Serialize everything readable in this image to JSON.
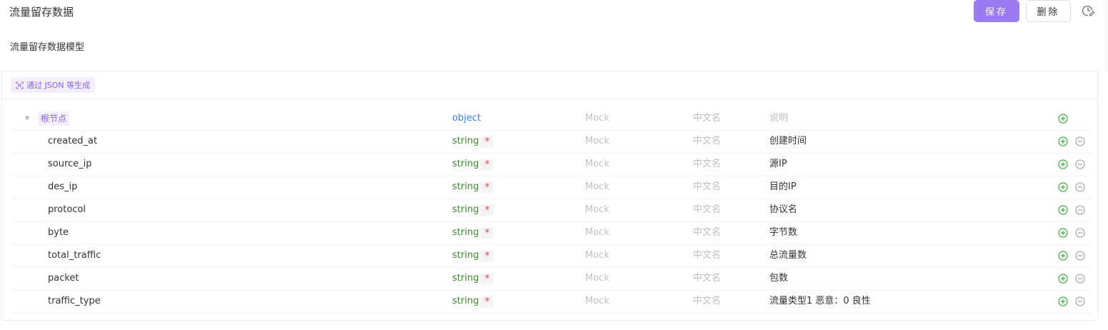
{
  "header": {
    "title": "流量留存数据",
    "save_label": "保存",
    "delete_label": "删除",
    "history_icon": "history-edit-icon"
  },
  "model": {
    "name": "流量留存数据模型"
  },
  "toolbar": {
    "generate_label": "通过 JSON 等生成",
    "generate_icon": "scan-icon"
  },
  "colors": {
    "accent": "#9b7cf0",
    "type_object": "#3c7fd9",
    "type_string": "#3a8c2c",
    "required": "#e8413c",
    "add_icon": "#3aa63a",
    "placeholder": "#bfbfbf"
  },
  "schema": {
    "root": {
      "name": "根节点",
      "type": "object",
      "mock_placeholder": "Mock",
      "cn_placeholder": "中文名",
      "desc_placeholder": "说明"
    },
    "fields": [
      {
        "name": "created_at",
        "type": "string",
        "required": "*",
        "mock": "Mock",
        "cn": "中文名",
        "desc": "创建时间"
      },
      {
        "name": "source_ip",
        "type": "string",
        "required": "*",
        "mock": "Mock",
        "cn": "中文名",
        "desc": "源IP"
      },
      {
        "name": "des_ip",
        "type": "string",
        "required": "*",
        "mock": "Mock",
        "cn": "中文名",
        "desc": "目的IP"
      },
      {
        "name": "protocol",
        "type": "string",
        "required": "*",
        "mock": "Mock",
        "cn": "中文名",
        "desc": "协议名"
      },
      {
        "name": "byte",
        "type": "string",
        "required": "*",
        "mock": "Mock",
        "cn": "中文名",
        "desc": "字节数"
      },
      {
        "name": "total_traffic",
        "type": "string",
        "required": "*",
        "mock": "Mock",
        "cn": "中文名",
        "desc": "总流量数"
      },
      {
        "name": "packet",
        "type": "string",
        "required": "*",
        "mock": "Mock",
        "cn": "中文名",
        "desc": "包数"
      },
      {
        "name": "traffic_type",
        "type": "string",
        "required": "*",
        "mock": "Mock",
        "cn": "中文名",
        "desc": "流量类型1 恶意：0 良性"
      }
    ]
  }
}
